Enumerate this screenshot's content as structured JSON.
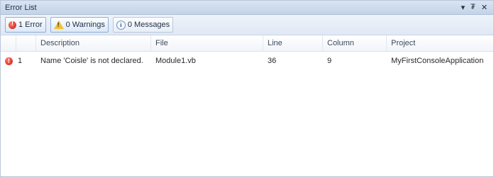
{
  "window": {
    "title": "Error List",
    "controls": {
      "pin": "▾",
      "autohide": "₮",
      "close": "✕"
    }
  },
  "toolbar": {
    "errors_label": "1 Error",
    "warnings_label": "0 Warnings",
    "messages_label": "0 Messages"
  },
  "columns": {
    "description": "Description",
    "file": "File",
    "line": "Line",
    "column": "Column",
    "project": "Project"
  },
  "rows": [
    {
      "icon": "error-icon",
      "number": "1",
      "description": "Name 'Coisle' is not declared.",
      "file": "Module1.vb",
      "line": "36",
      "column": "9",
      "project": "MyFirstConsoleApplication"
    }
  ],
  "colors": {
    "error": "#c41a0e",
    "warning": "#f1c232",
    "accent": "#8fb0d8"
  }
}
